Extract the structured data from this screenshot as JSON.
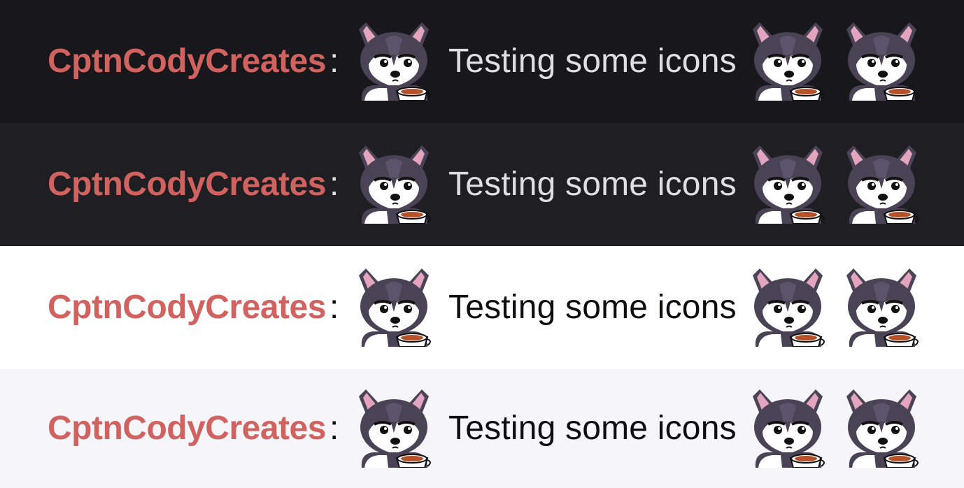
{
  "emote_name": "husky-coffee-icon",
  "rows": [
    {
      "username": "CptnCodyCreates",
      "colon": ":",
      "message": "Testing some icons",
      "background": "#18171b",
      "text_color": "#dedee3"
    },
    {
      "username": "CptnCodyCreates",
      "colon": ":",
      "message": "Testing some icons",
      "background": "#1f1e23",
      "text_color": "#dedee3"
    },
    {
      "username": "CptnCodyCreates",
      "colon": ":",
      "message": "Testing some icons",
      "background": "#ffffff",
      "text_color": "#0e0e10"
    },
    {
      "username": "CptnCodyCreates",
      "colon": ":",
      "message": "Testing some icons",
      "background": "#f6f5f9",
      "text_color": "#0e0e10"
    }
  ],
  "username_color": "#d0625f"
}
